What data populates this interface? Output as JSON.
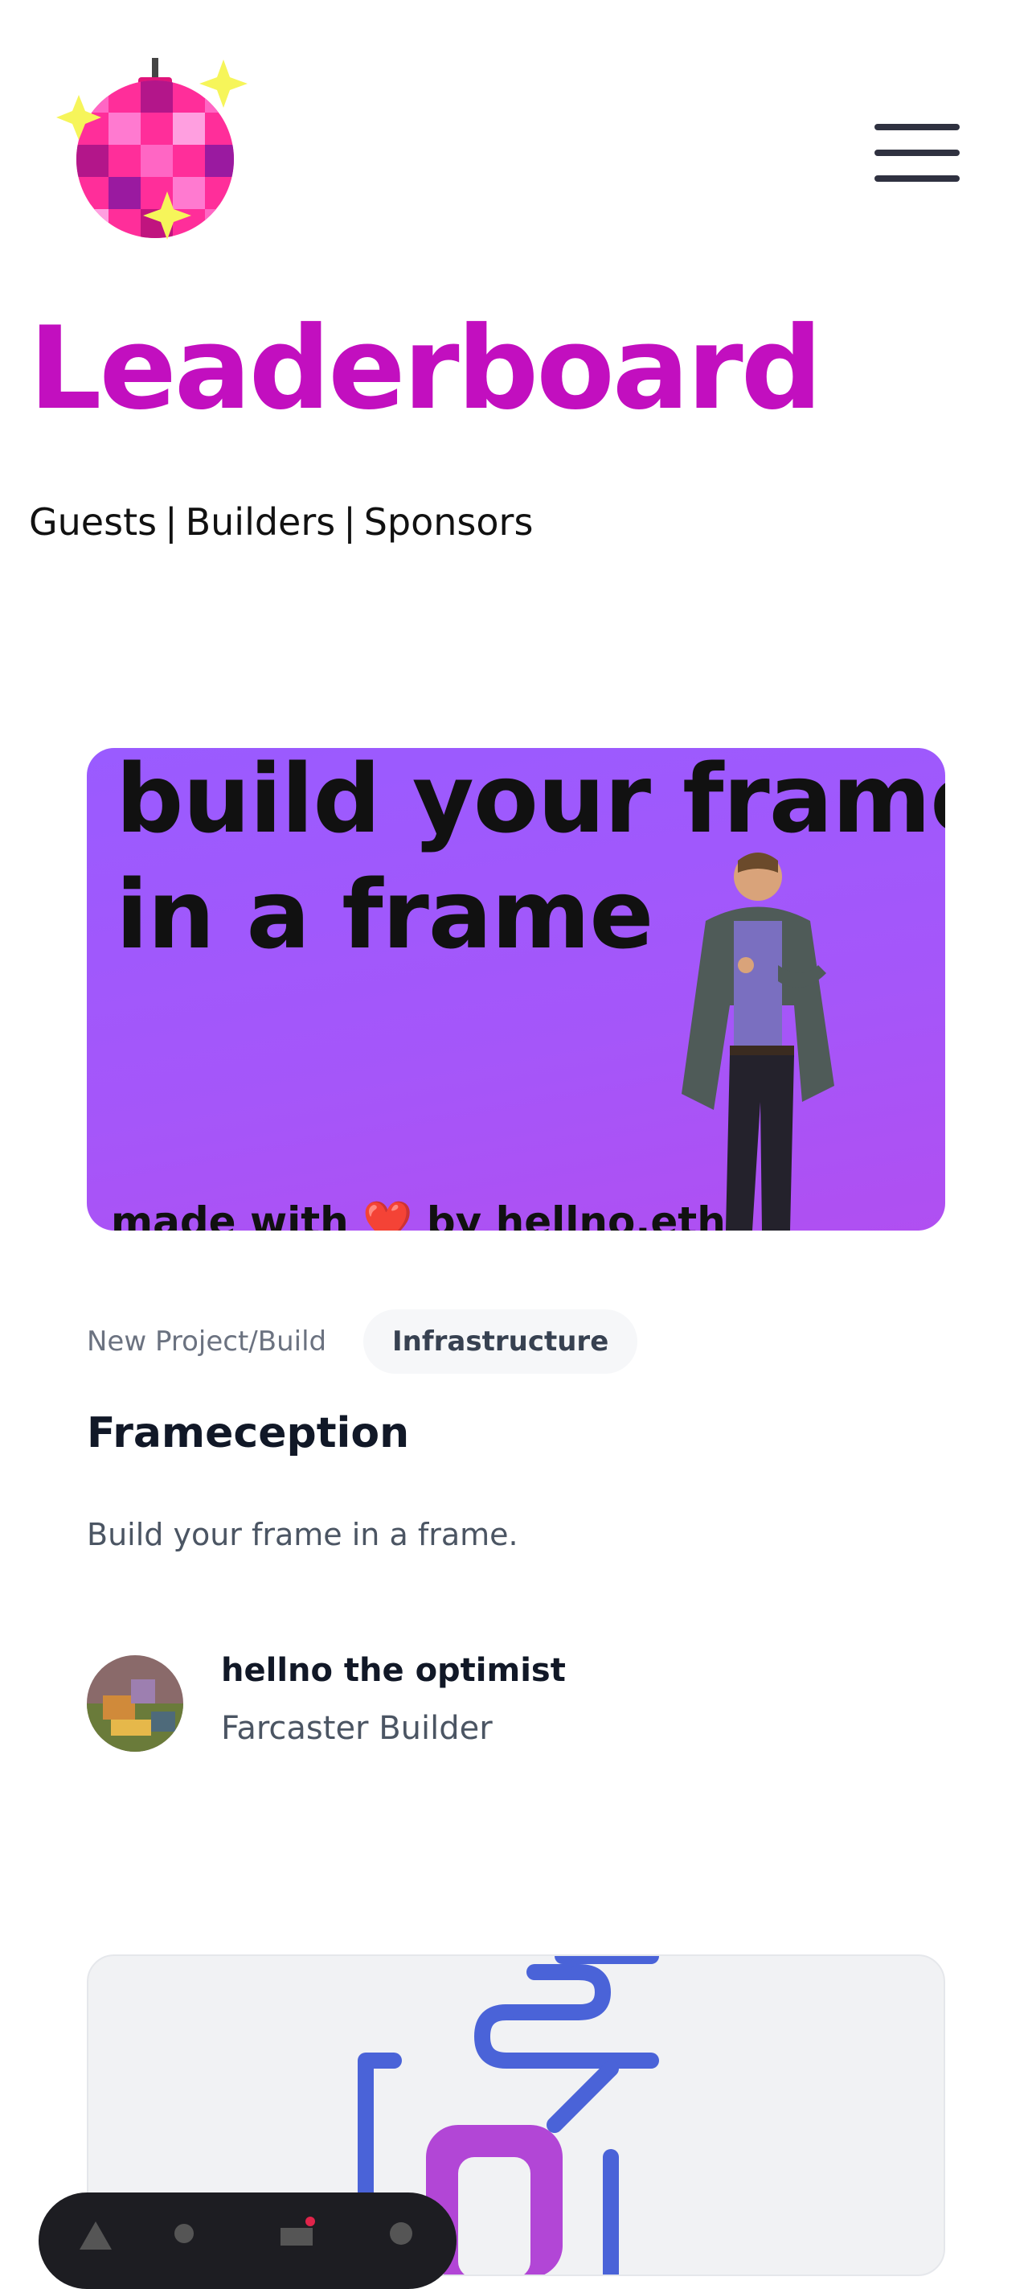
{
  "header": {
    "logo_icon": "disco-ball-icon",
    "menu_icon": "hamburger-menu-icon"
  },
  "page": {
    "title": "Leaderboard",
    "filters": [
      "Guests",
      "Builders",
      "Sponsors"
    ],
    "filter_separator": "|",
    "title_color": "#c20fbf"
  },
  "project": {
    "image": {
      "headline_line1": "build your frame",
      "headline_line2": "in a frame",
      "footer_prefix": "made with ",
      "footer_heart": "❤️",
      "footer_suffix": " by hellno.eth",
      "background_color": "#a556f9"
    },
    "category": "New Project/Build",
    "tag": "Infrastructure",
    "title": "Frameception",
    "description": "Build your frame in a frame.",
    "author": {
      "name": "hellno the optimist",
      "role": "Farcaster Builder"
    }
  },
  "next_project": {
    "image_icon": "abstract-logo-icon"
  },
  "bottom_bar": {
    "icons": [
      "home-icon",
      "activity-icon",
      "inbox-icon",
      "profile-icon"
    ]
  }
}
